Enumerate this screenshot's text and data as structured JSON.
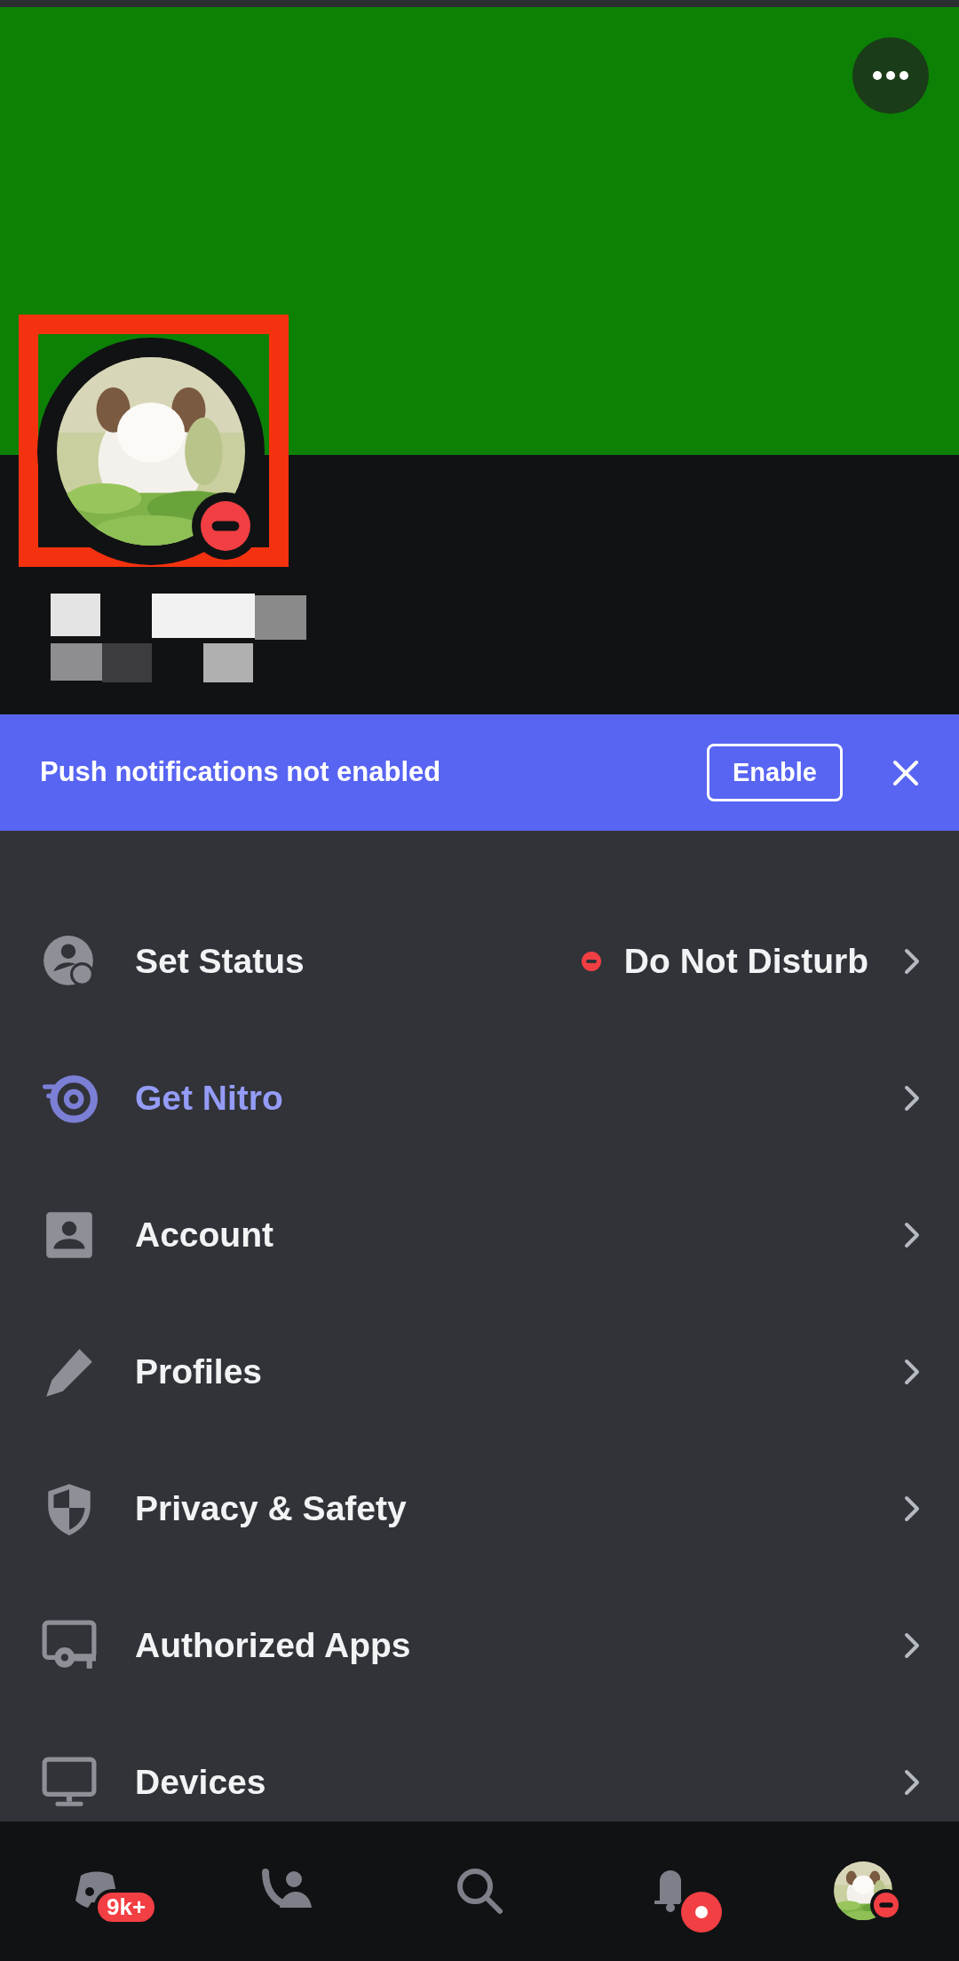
{
  "profile": {
    "avatar": {
      "kind": "picture",
      "do_not_disturb": true
    },
    "highlighted": true,
    "username": {
      "kind": "redacted"
    }
  },
  "banner": {
    "text": "Push notifications not enabled",
    "button": "Enable"
  },
  "menu": [
    {
      "label": "Set Status",
      "kind": "status",
      "value": "Do Not Disturb",
      "do_not_disturb": true
    },
    {
      "label": "Get Nitro",
      "kind": "nitro"
    },
    {
      "label": "Account",
      "kind": "setting"
    },
    {
      "label": "Profiles",
      "kind": "setting"
    },
    {
      "label": "Privacy & Safety",
      "kind": "setting"
    },
    {
      "label": "Authorized Apps",
      "kind": "setting"
    },
    {
      "label": "Devices",
      "kind": "setting"
    }
  ],
  "nav": [
    {
      "kind": "servers",
      "badge": "9k+"
    },
    {
      "kind": "friends"
    },
    {
      "kind": "search"
    },
    {
      "kind": "notifications",
      "unread": true
    },
    {
      "kind": "you",
      "do_not_disturb": true
    }
  ]
}
